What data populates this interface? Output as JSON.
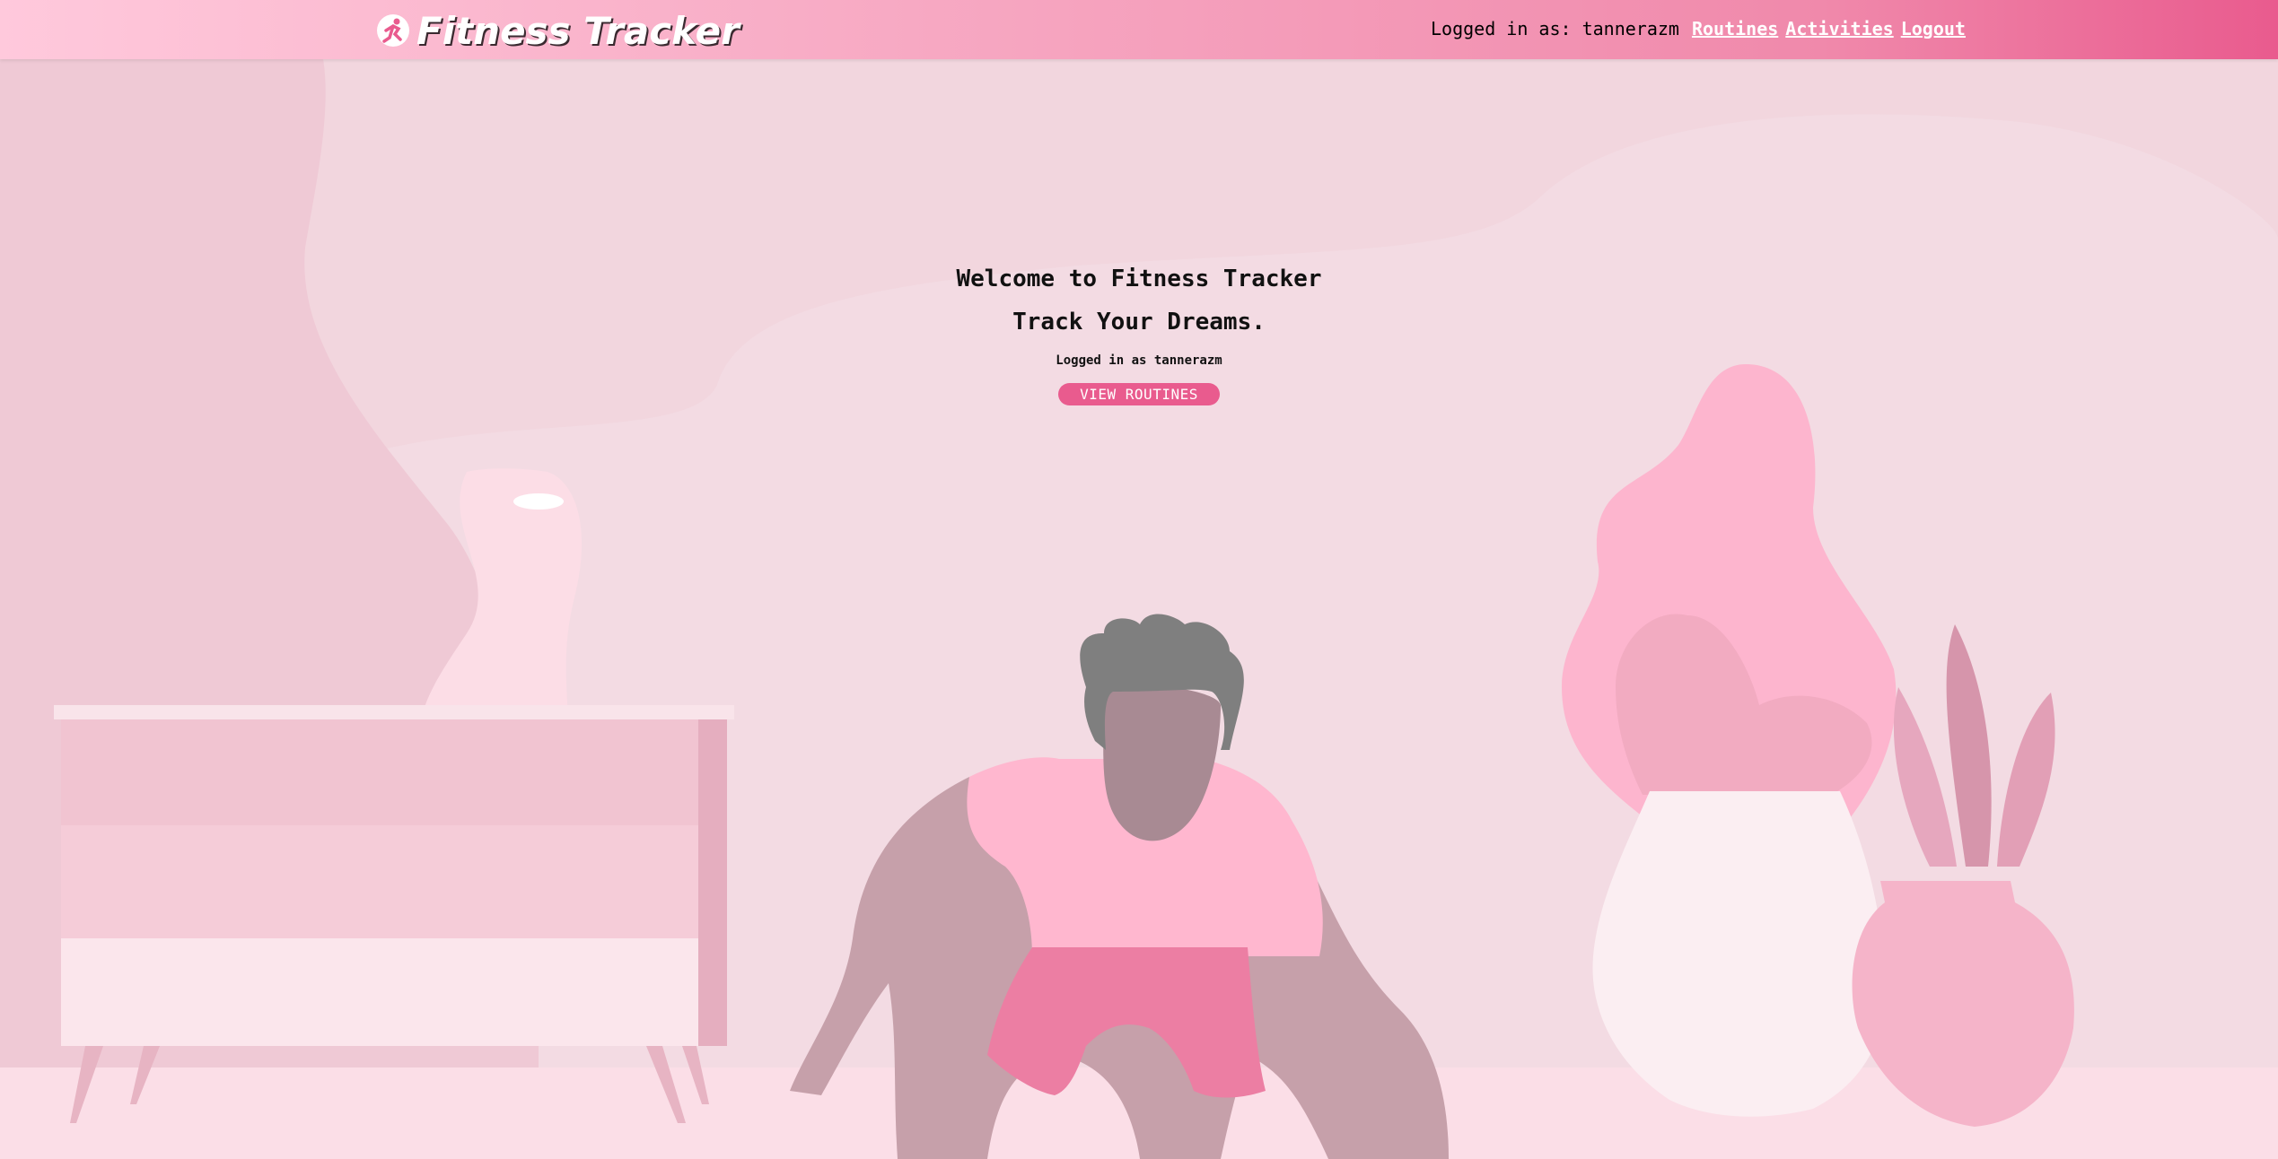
{
  "header": {
    "logo_text": "Fitness Tracker",
    "logged_in_label": "Logged in as: tannerazm",
    "nav": [
      {
        "label": "Routines"
      },
      {
        "label": "Activities"
      },
      {
        "label": "Logout"
      }
    ]
  },
  "main": {
    "title": "Welcome to Fitness Tracker",
    "subtitle": "Track Your Dreams.",
    "logged_in_text": "Logged in as tannerazm",
    "cta_label": "VIEW ROUTINES"
  },
  "colors": {
    "accent": "#e95b8e",
    "background": "#f2d6de"
  }
}
